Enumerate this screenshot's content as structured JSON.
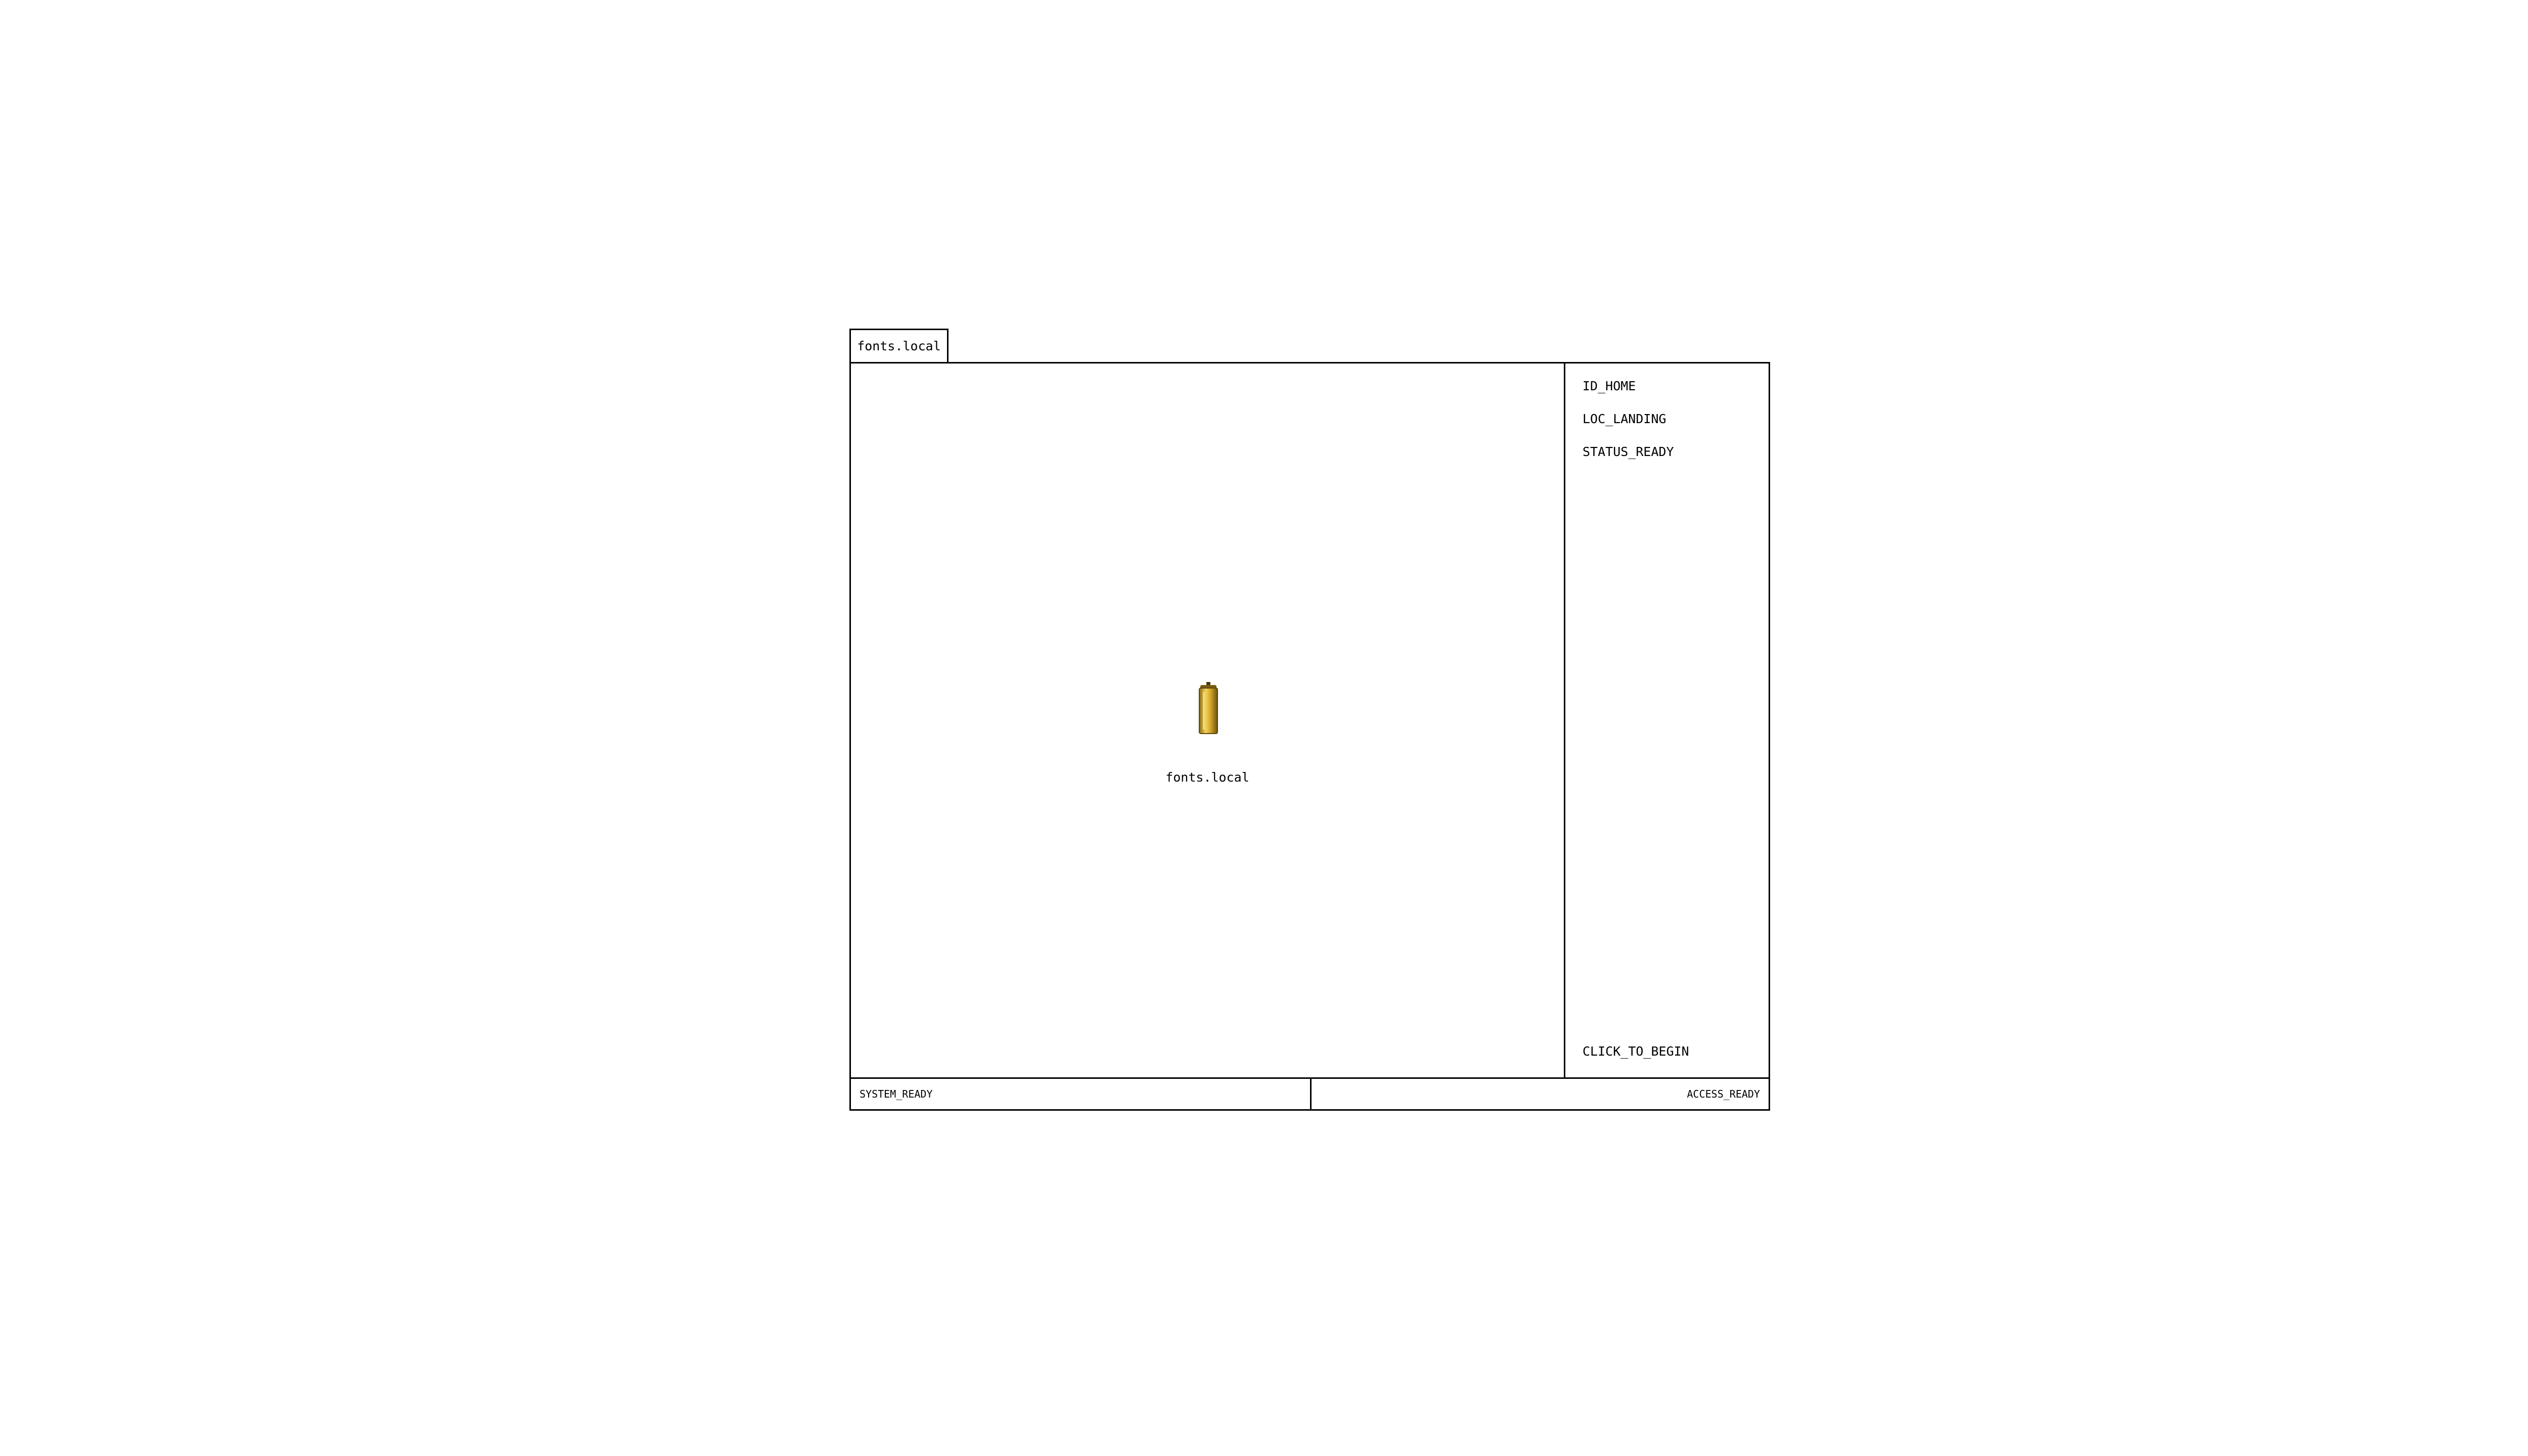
{
  "tab": {
    "label": "fonts.local"
  },
  "main": {
    "icon": "yellow-cylinder-icon",
    "label": "fonts.local"
  },
  "sidebar": {
    "items": [
      {
        "label": "ID_HOME"
      },
      {
        "label": "LOC_LANDING"
      },
      {
        "label": "STATUS_READY"
      }
    ],
    "action_label": "CLICK_TO_BEGIN"
  },
  "status_bar": {
    "left": "SYSTEM_READY",
    "right": "ACCESS_READY"
  },
  "colors": {
    "border": "#000000",
    "background": "#ffffff",
    "icon_gold": "#d4a92a"
  }
}
